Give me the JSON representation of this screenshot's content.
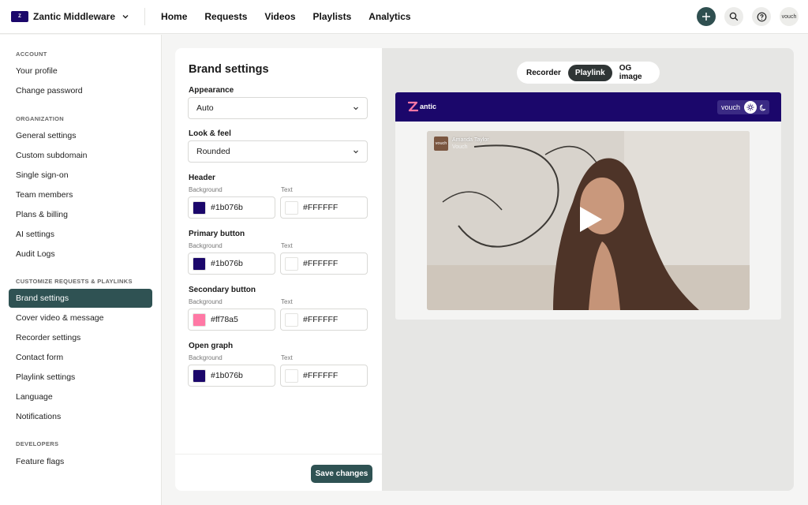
{
  "topbar": {
    "org_name": "Zantic Middleware",
    "nav": [
      "Home",
      "Requests",
      "Videos",
      "Playlists",
      "Analytics"
    ],
    "avatar_text": "vouch"
  },
  "sidebar": {
    "sections": [
      {
        "heading": "ACCOUNT",
        "items": [
          "Your profile",
          "Change password"
        ]
      },
      {
        "heading": "ORGANIZATION",
        "items": [
          "General settings",
          "Custom subdomain",
          "Single sign-on",
          "Team members",
          "Plans & billing",
          "AI settings",
          "Audit Logs"
        ]
      },
      {
        "heading": "CUSTOMIZE REQUESTS & PLAYLINKS",
        "items": [
          "Brand settings",
          "Cover video & message",
          "Recorder settings",
          "Contact form",
          "Playlink settings",
          "Language",
          "Notifications"
        ]
      },
      {
        "heading": "DEVELOPERS",
        "items": [
          "Feature flags"
        ]
      }
    ],
    "active_item": "Brand settings"
  },
  "settings": {
    "title": "Brand settings",
    "appearance": {
      "label": "Appearance",
      "value": "Auto"
    },
    "look_feel": {
      "label": "Look & feel",
      "value": "Rounded"
    },
    "groups": [
      {
        "title": "Header",
        "bg_label": "Background",
        "text_label": "Text",
        "bg": "#1b076b",
        "text": "#FFFFFF"
      },
      {
        "title": "Primary button",
        "bg_label": "Background",
        "text_label": "Text",
        "bg": "#1b076b",
        "text": "#FFFFFF"
      },
      {
        "title": "Secondary button",
        "bg_label": "Background",
        "text_label": "Text",
        "bg": "#ff78a5",
        "text": "#FFFFFF"
      },
      {
        "title": "Open graph",
        "bg_label": "Background",
        "text_label": "Text",
        "bg": "#1b076b",
        "text": "#FFFFFF"
      }
    ],
    "save_label": "Save changes"
  },
  "preview": {
    "tabs": [
      "Recorder",
      "Playlink",
      "OG image"
    ],
    "active_tab": "Playlink",
    "brand_logo_text": "antic",
    "vouch_label": "vouch",
    "video": {
      "author": "Amanda Taylor",
      "org": "Vouch",
      "avatar_text": "vouch"
    },
    "icons": [
      "sun-icon",
      "moon-icon",
      "play-icon"
    ]
  },
  "colors": {
    "accent": "#2f5253",
    "brand": "#1b076b",
    "secondary": "#ff78a5"
  }
}
